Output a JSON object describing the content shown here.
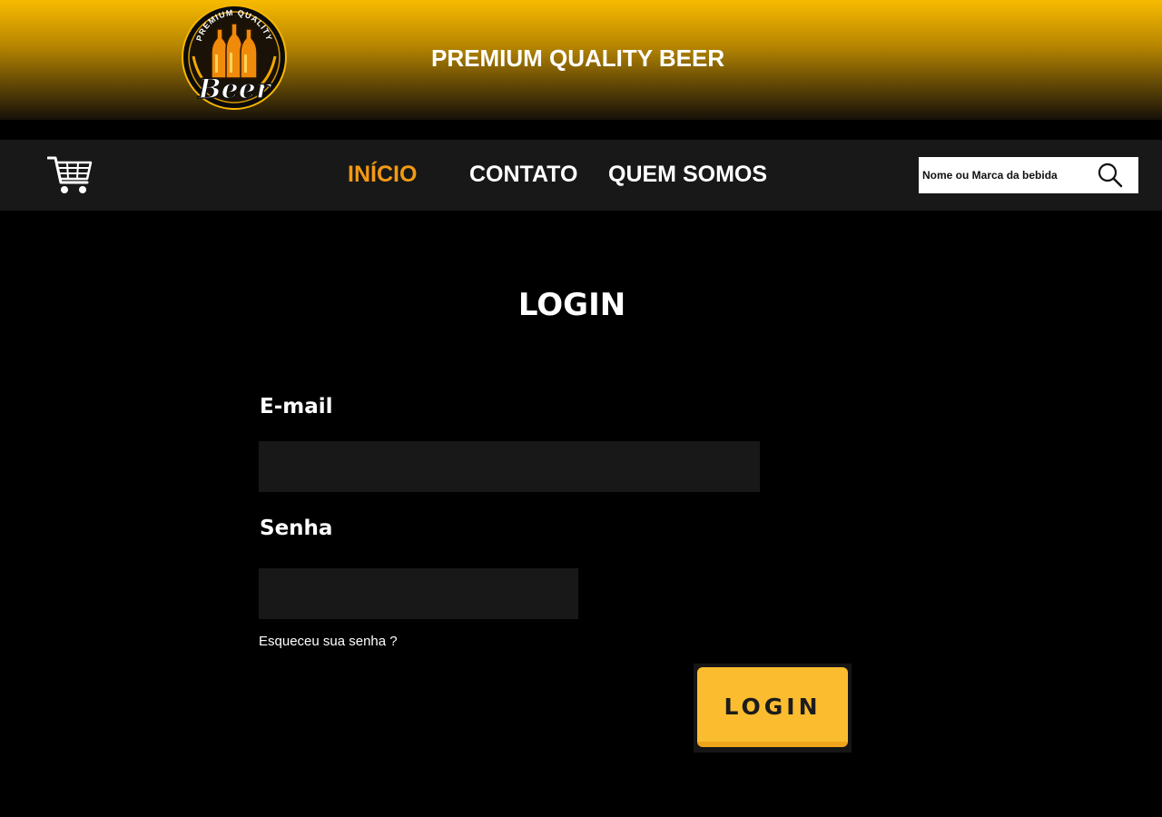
{
  "header": {
    "title": "PREMIUM QUALITY BEER",
    "logo": {
      "arc_text": "PREMIUM QUALITY",
      "script_text": "Beer"
    }
  },
  "nav": {
    "cart_icon": "shopping-cart-icon",
    "links": [
      {
        "label": "INÍCIO",
        "active": true
      },
      {
        "label": "CONTATO",
        "active": false
      },
      {
        "label": "QUEM SOMOS",
        "active": false
      }
    ],
    "active_color": "#f39a14",
    "search": {
      "placeholder": "Nome ou Marca da bebida",
      "icon": "search-icon"
    }
  },
  "login": {
    "title": "LOGIN",
    "email_label": "E-mail",
    "email_value": "",
    "password_label": "Senha",
    "password_value": "",
    "forgot_link": "Esqueceu sua senha ?",
    "submit_label": "LOGIN",
    "submit_color": "#fbbd2f"
  }
}
